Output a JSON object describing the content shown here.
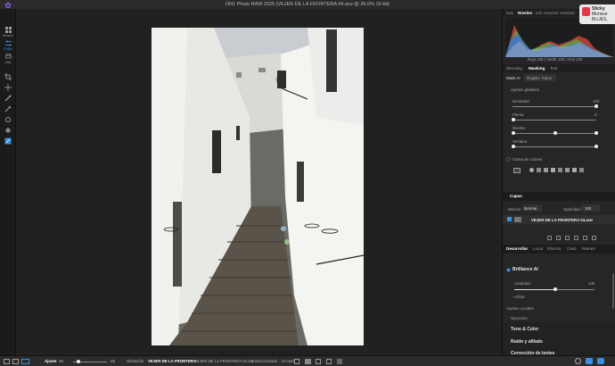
{
  "window": {
    "title": "ON1 Photo RAW 2025 (VEJER DE LA FRONTERA 04.arw @ 36.0% 16-bit)"
  },
  "left_rail": {
    "items": [
      {
        "label": "Browse"
      },
      {
        "label": "Editar"
      },
      {
        "label": "Más"
      }
    ]
  },
  "notification": {
    "title": "Sticky",
    "line1": "Morisse",
    "line2": "BLUES,"
  },
  "top_tabs": [
    {
      "label": "Nav"
    },
    {
      "label": "Niveles"
    },
    {
      "label": "Info"
    },
    {
      "label": "rmación"
    },
    {
      "label": "Historial"
    }
  ],
  "histogram": {
    "readout": "Rojo 136 | Verde 130 | Azul 124"
  },
  "mode_tabs": [
    {
      "label": "Blending"
    },
    {
      "label": "Masking"
    },
    {
      "label": "Text"
    }
  ],
  "mask_ai": {
    "label": "Mask AI",
    "region_label": "Región: Todos"
  },
  "ajustes_globales": {
    "title": "Ajustes globales",
    "sliders": [
      {
        "label": "Densidad",
        "value": "100",
        "fraction": 1.0
      },
      {
        "label": "Pluma",
        "value": "0",
        "fraction": 0.0
      },
      {
        "label": "Niveles",
        "value": "",
        "fraction": 0.5
      },
      {
        "label": "Ventana",
        "value": "",
        "fraction": 1.0
      }
    ]
  },
  "gama_de_colores": {
    "label": "Gama de colores"
  },
  "capas": {
    "title": "Capas",
    "blend_label": "Mezcla",
    "blend_value": "Normal",
    "opacity_label": "Opacidad",
    "opacity_value": "100",
    "layer_name": "VEJER DE LA FRONTERA 04.arw"
  },
  "develop_tabs": [
    {
      "label": "Desarrollar"
    },
    {
      "label": "Local"
    },
    {
      "label": "Efectos"
    },
    {
      "label": "Cielo"
    },
    {
      "label": "Retrato"
    }
  ],
  "brilliance": {
    "title": "Brilliance AI",
    "cantidad_label": "Cantidad",
    "cantidad_value": "100",
    "cantidad_fraction": 1.0,
    "afinar": "Afinar"
  },
  "ajustes_locales": "Ajustes Locales",
  "opciones": "Opciones",
  "sections": [
    {
      "title": "Tono & Color"
    },
    {
      "title": "Ruido y afilado"
    },
    {
      "title": "Corrección de lentes"
    }
  ],
  "statusbar": {
    "ajuste_label": "Ajuste",
    "zoom_value": "36",
    "zoom_fraction": 0.2,
    "slider_max": "35",
    "location_label": "Ubicación",
    "location_path": "VEJER DE LA FRONTERA",
    "file_name": "VEJER DE LA FRONTERA 04.arw",
    "selection": "1 seleccionado · 13 total"
  },
  "colors": {
    "accent": "#3b8fe0",
    "panel_bg": "#262626",
    "canvas_bg": "#212121"
  }
}
